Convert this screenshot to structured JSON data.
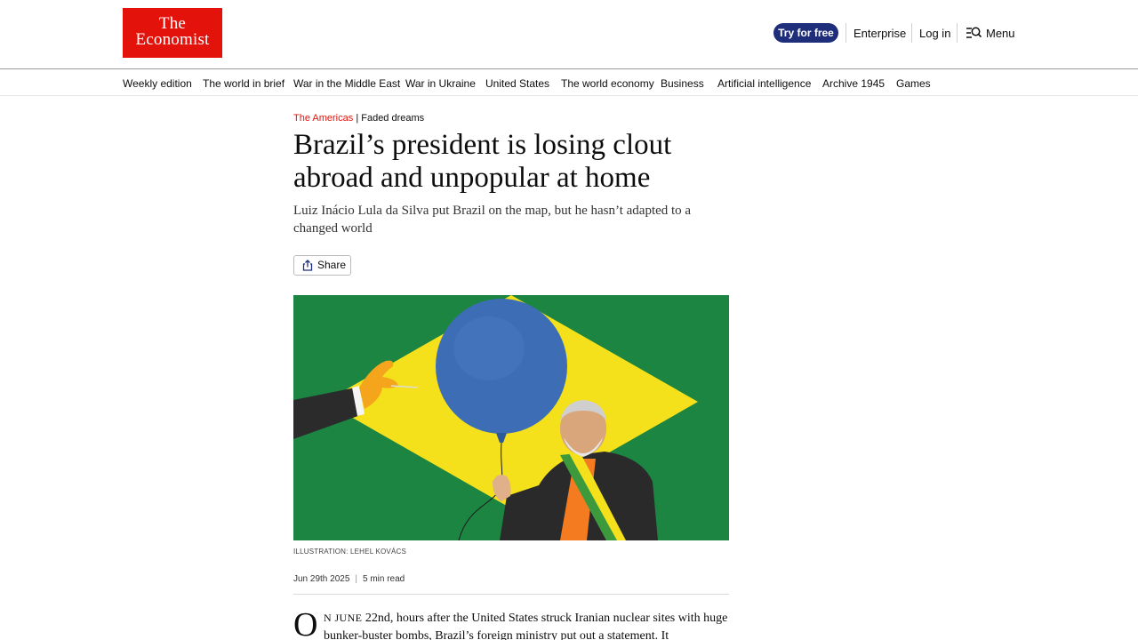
{
  "header": {
    "logo_line1": "The",
    "logo_line2": "Economist",
    "try_label": "Try for free",
    "enterprise_label": "Enterprise",
    "login_label": "Log in",
    "menu_label": "Menu",
    "brand_color": "#e3120b",
    "cta_color": "#1f2e7a"
  },
  "nav": {
    "items": [
      {
        "label": "Weekly edition"
      },
      {
        "label": "The world in brief"
      },
      {
        "label": "War in the Middle East"
      },
      {
        "label": "War in Ukraine"
      },
      {
        "label": "United States"
      },
      {
        "label": "The world economy"
      },
      {
        "label": "Business"
      },
      {
        "label": "Artificial intelligence"
      },
      {
        "label": "Archive 1945"
      },
      {
        "label": "Games"
      }
    ]
  },
  "article": {
    "section": "The Americas",
    "separator": "|",
    "rubric": "Faded dreams",
    "headline": "Brazil’s president is losing clout abroad and unpopular at home",
    "standfirst": "Luiz Inácio Lula da Silva put Brazil on the map, but he hasn’t adapted to a changed world",
    "share_label": "Share",
    "caption": "ILLUSTRATION: LEHEL KOVÁCS",
    "date": "Jun 29th 2025",
    "read_time": "5 min read",
    "dropcap": "O",
    "lead_smallcaps": "N JUNE",
    "lead_text": " 22nd, hours after the United States struck Iranian nuclear sites with huge bunker-buster bombs, Brazil’s foreign ministry put out a statement. It"
  }
}
